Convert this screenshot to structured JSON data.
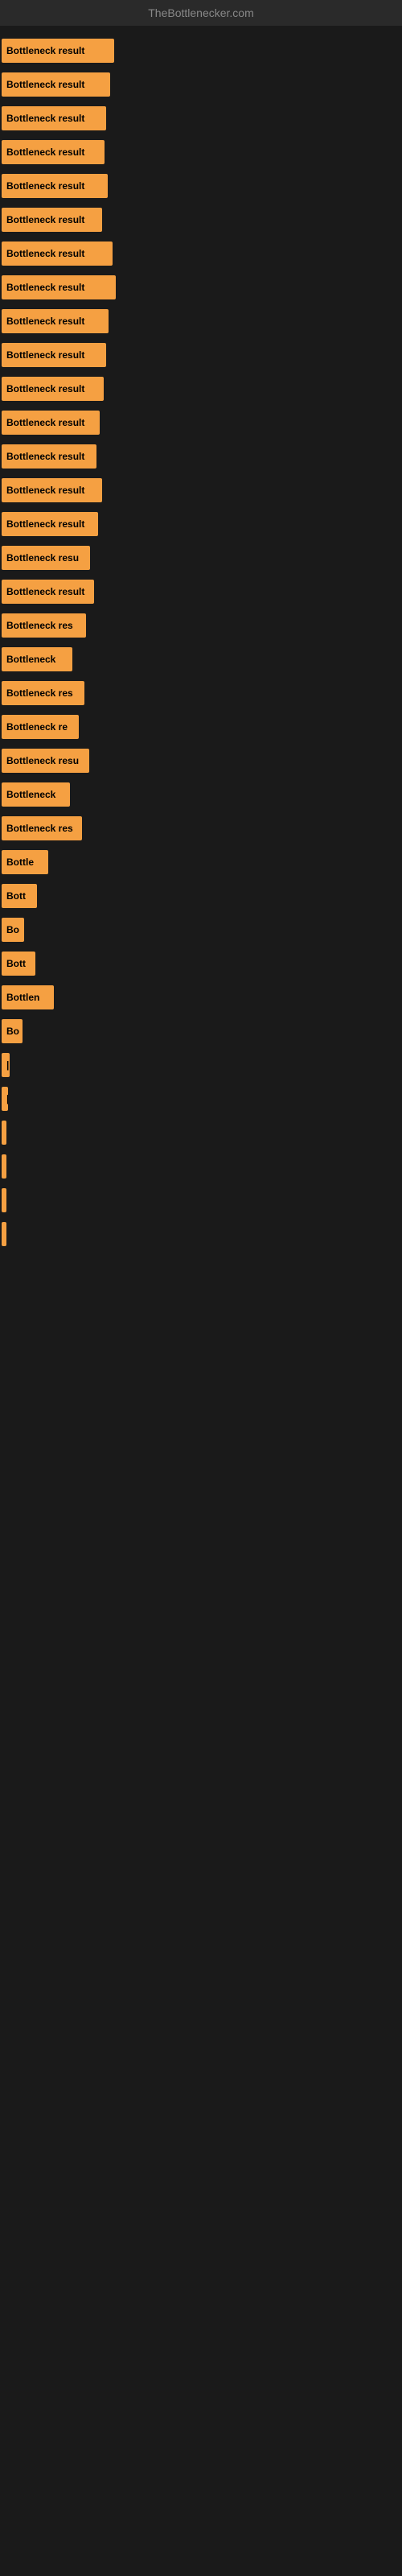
{
  "site": {
    "title": "TheBottlenecker.com"
  },
  "bars": [
    {
      "label": "Bottleneck result",
      "width": 140
    },
    {
      "label": "Bottleneck result",
      "width": 135
    },
    {
      "label": "Bottleneck result",
      "width": 130
    },
    {
      "label": "Bottleneck result",
      "width": 128
    },
    {
      "label": "Bottleneck result",
      "width": 132
    },
    {
      "label": "Bottleneck result",
      "width": 125
    },
    {
      "label": "Bottleneck result",
      "width": 138
    },
    {
      "label": "Bottleneck result",
      "width": 142
    },
    {
      "label": "Bottleneck result",
      "width": 133
    },
    {
      "label": "Bottleneck result",
      "width": 130
    },
    {
      "label": "Bottleneck result",
      "width": 127
    },
    {
      "label": "Bottleneck result",
      "width": 122
    },
    {
      "label": "Bottleneck result",
      "width": 118
    },
    {
      "label": "Bottleneck result",
      "width": 125
    },
    {
      "label": "Bottleneck result",
      "width": 120
    },
    {
      "label": "Bottleneck resu",
      "width": 110
    },
    {
      "label": "Bottleneck result",
      "width": 115
    },
    {
      "label": "Bottleneck res",
      "width": 105
    },
    {
      "label": "Bottleneck",
      "width": 88
    },
    {
      "label": "Bottleneck res",
      "width": 103
    },
    {
      "label": "Bottleneck re",
      "width": 96
    },
    {
      "label": "Bottleneck resu",
      "width": 109
    },
    {
      "label": "Bottleneck",
      "width": 85
    },
    {
      "label": "Bottleneck res",
      "width": 100
    },
    {
      "label": "Bottle",
      "width": 58
    },
    {
      "label": "Bott",
      "width": 44
    },
    {
      "label": "Bo",
      "width": 28
    },
    {
      "label": "Bott",
      "width": 42
    },
    {
      "label": "Bottlen",
      "width": 65
    },
    {
      "label": "Bo",
      "width": 26
    },
    {
      "label": "|",
      "width": 10
    },
    {
      "label": "|",
      "width": 8
    },
    {
      "label": "▪",
      "width": 6
    },
    {
      "label": "",
      "width": 3
    },
    {
      "label": "",
      "width": 2
    },
    {
      "label": "",
      "width": 1
    }
  ]
}
